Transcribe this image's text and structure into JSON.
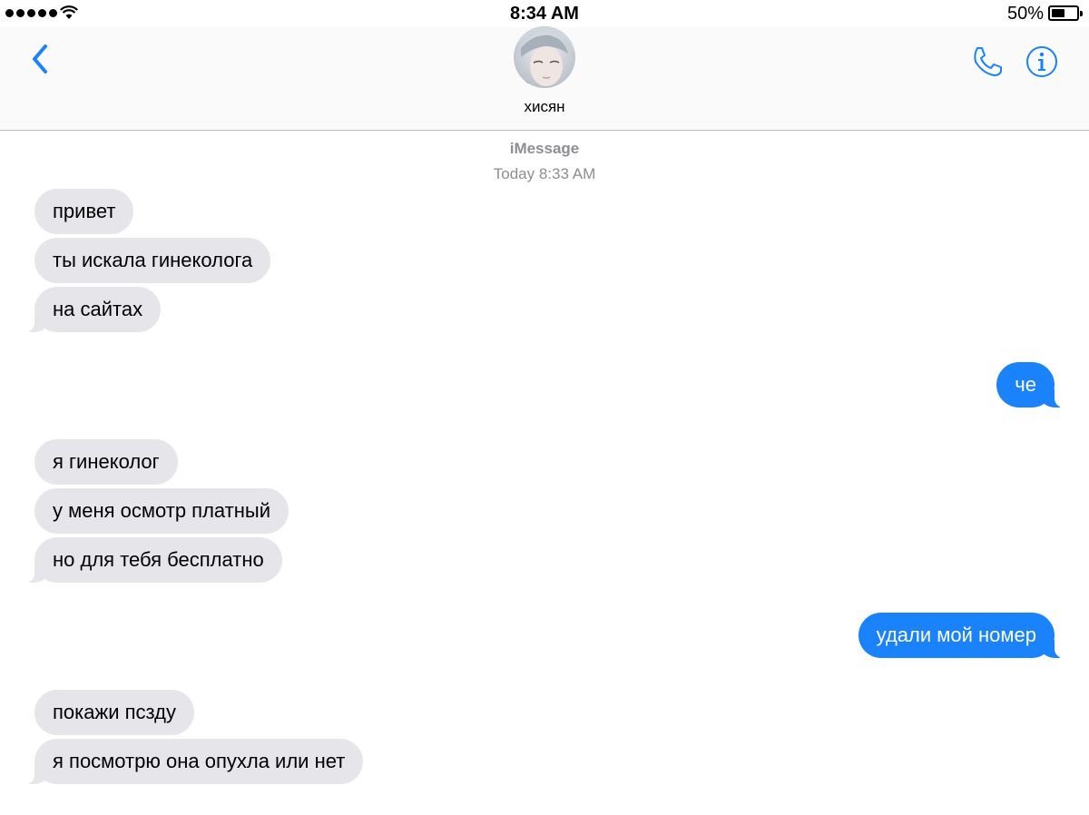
{
  "status_bar": {
    "time": "8:34 AM",
    "battery_percent": "50%",
    "battery_level": 0.5,
    "signal_bars": 5
  },
  "header": {
    "contact_name": "хисян",
    "icons": [
      "back-chevron-icon",
      "phone-icon",
      "info-icon"
    ],
    "accent_color": "#1a82fb"
  },
  "conversation": {
    "service": "iMessage",
    "timestamp": "Today 8:33 AM",
    "messages": [
      {
        "from": "them",
        "text": "привет"
      },
      {
        "from": "them",
        "text": "ты искала гинеколога"
      },
      {
        "from": "them",
        "text": "на сайтах"
      },
      {
        "from": "me",
        "text": "че"
      },
      {
        "from": "them",
        "text": "я гинеколог"
      },
      {
        "from": "them",
        "text": "у меня осмотр платный"
      },
      {
        "from": "them",
        "text": "но для тебя бесплатно"
      },
      {
        "from": "me",
        "text": "удали мой номер"
      },
      {
        "from": "them",
        "text": "покажи псзду"
      },
      {
        "from": "them",
        "text": "я посмотрю она опухла или нет"
      }
    ]
  },
  "colors": {
    "incoming_bubble": "#e5e5ea",
    "outgoing_bubble": "#1a82fb",
    "meta_text": "#8e8e93"
  }
}
